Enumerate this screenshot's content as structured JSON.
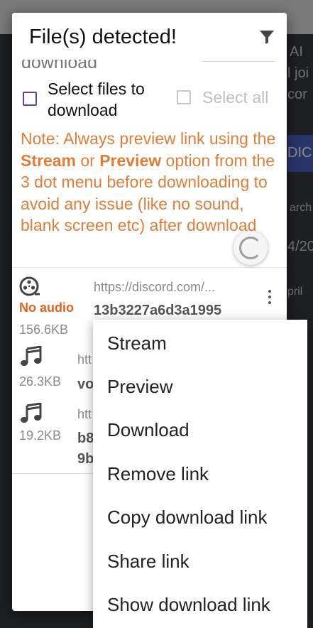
{
  "dialog": {
    "title": "File(s) detected!",
    "partial_text": "download",
    "select_files_label_line1": "Select files to",
    "select_files_label_line2": "download",
    "select_all_label": "Select all",
    "note": {
      "prefix": "Note: Always preview link using the ",
      "stream_word": "Stream",
      "or_word": " or ",
      "preview_word": "Preview",
      "line_rest1": " option from the 3 dot menu before downloading to avoid any issue (like no sound, ",
      "blank_fragment": "blank",
      "line_rest2": " screen etc) after download"
    },
    "files": [
      {
        "icon": "film-reel-icon",
        "badge": "No audio",
        "size": "156.6KB",
        "url": "https://discord.com/...",
        "name": "13b3227a6d3a1995"
      },
      {
        "icon": "music-note-icon",
        "size": "26.3KB",
        "url": "htt",
        "name": "vo"
      },
      {
        "icon": "music-note-icon",
        "size": "19.2KB",
        "url": "htt",
        "name_line1": "b8",
        "name_line2": "9b"
      }
    ]
  },
  "menu": {
    "items": [
      "Stream",
      "Preview",
      "Download",
      "Remove link",
      "Copy download link",
      "Share link",
      "Show download link"
    ]
  },
  "background": {
    "texts": [
      "AI",
      "l joi",
      "cor",
      "DIC",
      "arch",
      "4/20",
      "pril"
    ]
  },
  "colors": {
    "accent_orange": "#e07d39",
    "checkbox_purple": "#6b3fa0",
    "no_audio": "#e0631f"
  }
}
